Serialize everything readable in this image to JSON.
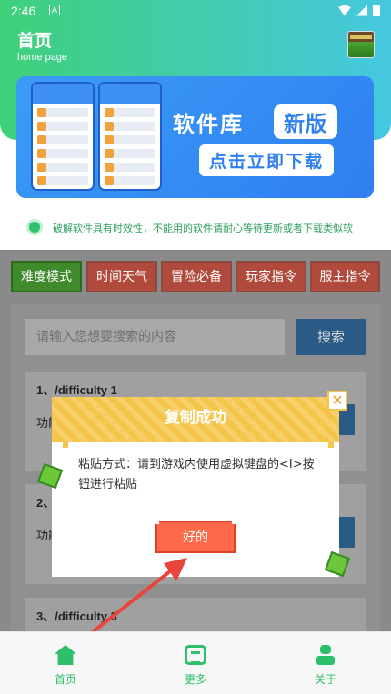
{
  "status_bar": {
    "time": "2:46",
    "notification_icon": "A"
  },
  "header": {
    "title": "首页",
    "subtitle": "home page"
  },
  "banner": {
    "title": "软件库",
    "badge": "新版",
    "cta": "点击立即下载"
  },
  "notice": {
    "text": "破解软件具有时效性，不能用的软件请耐心等待更新或者下载类似软"
  },
  "tabs": [
    {
      "label": "难度模式",
      "active": true
    },
    {
      "label": "时间天气",
      "active": false
    },
    {
      "label": "冒险必备",
      "active": false
    },
    {
      "label": "玩家指令",
      "active": false
    },
    {
      "label": "服主指令",
      "active": false
    }
  ],
  "search": {
    "placeholder": "请输入您想要搜索的内容",
    "button": "搜索"
  },
  "commands": [
    {
      "title": "1、/difficulty 1",
      "func": "功能"
    },
    {
      "title": "2、",
      "func": "功能"
    },
    {
      "title": "3、/difficulty 3",
      "func": ""
    }
  ],
  "modal": {
    "title": "复制成功",
    "body": "粘贴方式：请到游戏内使用虚拟键盘的<I>按钮进行粘贴",
    "ok": "好的",
    "close": "✕"
  },
  "bottom_nav": [
    {
      "label": "首页",
      "icon": "home-icon"
    },
    {
      "label": "更多",
      "icon": "more-icon"
    },
    {
      "label": "关于",
      "icon": "user-icon"
    }
  ],
  "colors": {
    "accent": "#2dbf6a",
    "banner": "#2f7ff0",
    "modal_header": "#f5c54a",
    "ok_button": "#ff6a4a"
  }
}
